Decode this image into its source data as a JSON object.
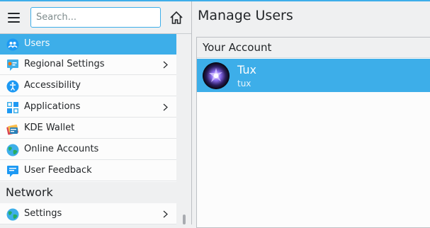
{
  "search": {
    "placeholder": "Search..."
  },
  "sidebar": {
    "items": [
      {
        "label": "Users",
        "icon": "users-icon",
        "has_submenu": false,
        "selected": true
      },
      {
        "label": "Regional Settings",
        "icon": "regional-settings-icon",
        "has_submenu": true
      },
      {
        "label": "Accessibility",
        "icon": "accessibility-icon",
        "has_submenu": false
      },
      {
        "label": "Applications",
        "icon": "applications-icon",
        "has_submenu": true
      },
      {
        "label": "KDE Wallet",
        "icon": "kde-wallet-icon",
        "has_submenu": false
      },
      {
        "label": "Online Accounts",
        "icon": "globe-icon",
        "has_submenu": false
      },
      {
        "label": "User Feedback",
        "icon": "feedback-icon",
        "has_submenu": false
      }
    ],
    "categories": [
      {
        "label": "Network"
      }
    ],
    "network_items": [
      {
        "label": "Settings",
        "icon": "globe-icon",
        "has_submenu": true
      }
    ]
  },
  "main": {
    "title": "Manage Users",
    "section_header": "Your Account",
    "account": {
      "name": "Tux",
      "login": "tux"
    }
  },
  "colors": {
    "accent": "#3daee9",
    "window_bg": "#eff0f1",
    "view_bg": "#fcfcfc",
    "text": "#232629"
  }
}
